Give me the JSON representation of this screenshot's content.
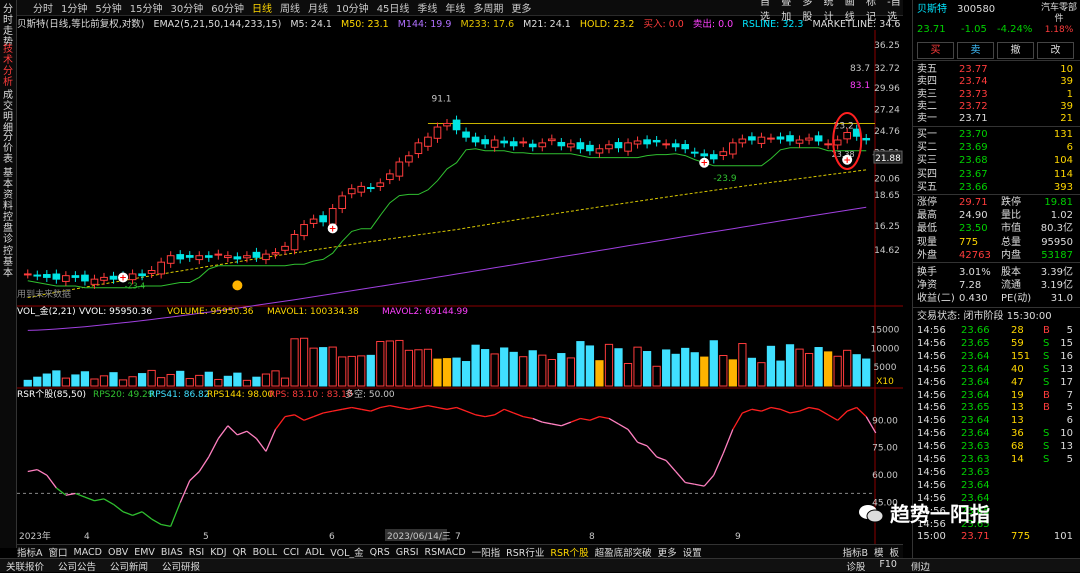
{
  "left_tabs": [
    "分时走势",
    "技术分析",
    "成交明细",
    "分价表",
    "基本资料",
    "控盘诊",
    "控基本"
  ],
  "toolbar": {
    "periods": [
      "分时",
      "1分钟",
      "5分钟",
      "15分钟",
      "30分钟",
      "60分钟",
      "日线",
      "周线",
      "月线",
      "10分钟",
      "45日线",
      "季线",
      "年线",
      "多周期",
      "更多"
    ],
    "active": "日线",
    "tools": [
      "自选",
      "叠加",
      "多股",
      "统计",
      "画线",
      "标记",
      "-自选"
    ]
  },
  "indicators_main": {
    "title": "贝斯特(日线,等比前复权,对数)",
    "ema2": "EMA2(5,21,50,144,233,15)",
    "m5": "M5: 24.1",
    "m50": "M50: 23.1",
    "m144": "M144: 19.9",
    "m233": "M233: 17.6",
    "m21": "M21: 24.1",
    "hold": "HOLD: 23.2",
    "buy": "买入: 0.0",
    "sell": "卖出: 0.0",
    "rsline": "RSLINE: 32.3",
    "market": "MARKETLINE: 34.6"
  },
  "volume_header": {
    "title": "VOL_金(2,21)",
    "vvol": "VVOL: 95950.36",
    "volume": "VOLUME: 95950.36",
    "mavol1": "MAVOL1: 100334.38",
    "mavol2": "MAVOL2: 69144.99"
  },
  "rsr_header": {
    "title": "RSR个股(85,50)",
    "rps20": "RPS20: 49.29",
    "rps41": "RPS41: 86.82",
    "rps144": "RPS144: 98.00",
    "rps": "RPS: 83.10 : 83.10",
    "duokong": "多空: 50.00"
  },
  "chart_annotations": {
    "peak_label": "91.1",
    "low_label": "-23.9",
    "high_right": "23.2",
    "mid_label": "23.38",
    "left_low": "-23.4",
    "right_83_7": "83.7",
    "right_83_1": "83.1",
    "future_label": "用到未来数据",
    "last_price_tag": "21.88",
    "minus23": "-23."
  },
  "chart_data": [
    {
      "type": "line",
      "title": "贝斯特(日线,等比前复权,对数)",
      "x": [
        "2023年",
        "4",
        "5",
        "6",
        "2023/06/14/三",
        "7",
        "8",
        "9"
      ],
      "yticks": [
        36.25,
        32.72,
        29.96,
        27.24,
        24.76,
        22.51,
        20.06,
        18.65,
        16.25,
        14.62
      ],
      "series": [
        {
          "name": "close",
          "values": [
            13.1,
            13.0,
            12.9,
            12.8,
            13.0,
            12.9,
            12.7,
            12.8,
            12.9,
            12.8,
            12.9,
            13.1,
            13.0,
            13.3,
            13.8,
            14.2,
            14.0,
            14.1,
            14.2,
            14.1,
            14.3,
            14.2,
            14.0,
            14.2,
            14.1,
            14.3,
            14.4,
            14.8,
            15.6,
            16.3,
            16.7,
            16.5,
            17.5,
            18.5,
            19.1,
            19.3,
            19.2,
            19.6,
            20.4,
            21.5,
            22.1,
            23.4,
            24.0,
            25.1,
            25.5,
            24.8,
            24.0,
            23.5,
            23.3,
            23.7,
            23.4,
            23.1,
            23.5,
            23.0,
            23.4,
            23.8,
            23.1,
            23.3,
            22.8,
            22.6,
            22.8,
            23.2,
            22.9,
            23.4,
            23.6,
            23.3,
            23.5,
            23.3,
            23.0,
            22.8,
            22.4,
            22.1,
            21.8,
            22.5,
            23.4,
            23.8,
            23.7,
            24.0,
            23.9,
            23.8,
            23.6,
            23.7,
            23.9,
            23.6,
            23.3,
            23.7,
            24.5,
            24.1,
            23.71
          ]
        },
        {
          "name": "M233",
          "values": [
            10.2,
            17.6
          ]
        }
      ]
    },
    {
      "type": "bar",
      "title": "VOL_金(2,21)",
      "yticks": [
        15000,
        10000,
        5000
      ],
      "unit": "X10"
    },
    {
      "type": "line",
      "title": "RSR个股(85,50)",
      "yticks": [
        90.0,
        75.0,
        60.0,
        45.0
      ],
      "series": [
        {
          "name": "RPS",
          "values": [
            62,
            63,
            60,
            53,
            49,
            50,
            48,
            46,
            47,
            44,
            40,
            38,
            40,
            36,
            33,
            32,
            45,
            57,
            62,
            70,
            80,
            87,
            82,
            84,
            80,
            73,
            85,
            92,
            93,
            90,
            92,
            94,
            95,
            96,
            97,
            96,
            95,
            97,
            98,
            97,
            96,
            97,
            98,
            97,
            96,
            97,
            95,
            93,
            92,
            93,
            96,
            94,
            92,
            91,
            89,
            88,
            87,
            89,
            91,
            90,
            92,
            91,
            88,
            85,
            78,
            76,
            70,
            68,
            62,
            56,
            55,
            54,
            60,
            72,
            85,
            94,
            96,
            95,
            97,
            96,
            94,
            95,
            97,
            96,
            93,
            90,
            95,
            97,
            92,
            83.1
          ]
        }
      ]
    }
  ],
  "right_panel": {
    "name": "贝斯特",
    "code": "300580",
    "industry": "汽车零部件",
    "industry_pct": "1.18%",
    "price": "23.71",
    "change": "-1.05",
    "change_pct": "-4.24%",
    "buttons": [
      "买",
      "卖",
      "撤",
      "改"
    ],
    "asks": [
      {
        "label": "卖五",
        "price": "23.77",
        "vol": "10"
      },
      {
        "label": "卖四",
        "price": "23.74",
        "vol": "39"
      },
      {
        "label": "卖三",
        "price": "23.73",
        "vol": "1"
      },
      {
        "label": "卖二",
        "price": "23.72",
        "vol": "39"
      },
      {
        "label": "卖一",
        "price": "23.71",
        "vol": "21"
      }
    ],
    "bids": [
      {
        "label": "买一",
        "price": "23.70",
        "vol": "131"
      },
      {
        "label": "买二",
        "price": "23.69",
        "vol": "6"
      },
      {
        "label": "买三",
        "price": "23.68",
        "vol": "104"
      },
      {
        "label": "买四",
        "price": "23.67",
        "vol": "114"
      },
      {
        "label": "买五",
        "price": "23.66",
        "vol": "393"
      }
    ],
    "stats": [
      {
        "l1": "涨停",
        "v1": "29.71",
        "l2": "跌停",
        "v2": "19.81"
      },
      {
        "l1": "最高",
        "v1": "24.90",
        "l2": "量比",
        "v2": "1.02"
      },
      {
        "l1": "最低",
        "v1": "23.50",
        "l2": "市值",
        "v2": "80.3亿"
      },
      {
        "l1": "现量",
        "v1": "775",
        "l2": "总量",
        "v2": "95950"
      },
      {
        "l1": "外盘",
        "v1": "42763",
        "l2": "内盘",
        "v2": "53187"
      },
      {
        "l1": "换手",
        "v1": "3.01%",
        "l2": "股本",
        "v2": "3.39亿"
      },
      {
        "l1": "净资",
        "v1": "7.28",
        "l2": "流通",
        "v2": "3.19亿"
      },
      {
        "l1": "收益(二)",
        "v1": "0.430",
        "l2": "PE(动)",
        "v2": "31.0"
      }
    ],
    "trade_status": "交易状态: 闭市阶段 15:30:00",
    "ticks": [
      {
        "t": "14:56",
        "p": "23.66",
        "v": "28",
        "s": "B",
        "n": "5"
      },
      {
        "t": "14:56",
        "p": "23.65",
        "v": "59",
        "s": "S",
        "n": "15"
      },
      {
        "t": "14:56",
        "p": "23.64",
        "v": "151",
        "s": "S",
        "n": "16"
      },
      {
        "t": "14:56",
        "p": "23.64",
        "v": "40",
        "s": "S",
        "n": "13"
      },
      {
        "t": "14:56",
        "p": "23.64",
        "v": "47",
        "s": "S",
        "n": "17"
      },
      {
        "t": "14:56",
        "p": "23.64",
        "v": "19",
        "s": "B",
        "n": "7"
      },
      {
        "t": "14:56",
        "p": "23.65",
        "v": "13",
        "s": "B",
        "n": "5"
      },
      {
        "t": "14:56",
        "p": "23.64",
        "v": "13",
        "s": "",
        "n": "6"
      },
      {
        "t": "14:56",
        "p": "23.64",
        "v": "36",
        "s": "S",
        "n": "10"
      },
      {
        "t": "14:56",
        "p": "23.63",
        "v": "68",
        "s": "S",
        "n": "13"
      },
      {
        "t": "14:56",
        "p": "23.63",
        "v": "14",
        "s": "S",
        "n": "5"
      },
      {
        "t": "14:56",
        "p": "23.63",
        "v": "",
        "s": "",
        "n": ""
      },
      {
        "t": "14:56",
        "p": "23.64",
        "v": "",
        "s": "",
        "n": ""
      },
      {
        "t": "14:56",
        "p": "23.64",
        "v": "",
        "s": "",
        "n": ""
      },
      {
        "t": "14:56",
        "p": "23.65",
        "v": "",
        "s": "",
        "n": ""
      },
      {
        "t": "14:56",
        "p": "23.65",
        "v": "",
        "s": "",
        "n": ""
      },
      {
        "t": "15:00",
        "p": "23.71",
        "v": "775",
        "s": "",
        "n": "101"
      }
    ]
  },
  "bottom_tabs": [
    "指标A",
    "窗口",
    "MACD",
    "OBV",
    "EMV",
    "BIAS",
    "RSI",
    "KDJ",
    "QR",
    "BOLL",
    "CCI",
    "ADL",
    "VOL_金",
    "QRS",
    "GRSI",
    "RSMACD",
    "一阳指",
    "RSR行业",
    "RSR个股",
    "超盈底部突破",
    "更多",
    "设置"
  ],
  "bottom_active": "RSR个股",
  "bottom_right": [
    "指标B",
    "模",
    "板"
  ],
  "statusbar": [
    "关联报价",
    "公司公告",
    "公司新闻",
    "公司研报"
  ],
  "statusbar_right": [
    "诊股",
    "F10",
    "侧边"
  ],
  "watermark": "趋势一阳指"
}
